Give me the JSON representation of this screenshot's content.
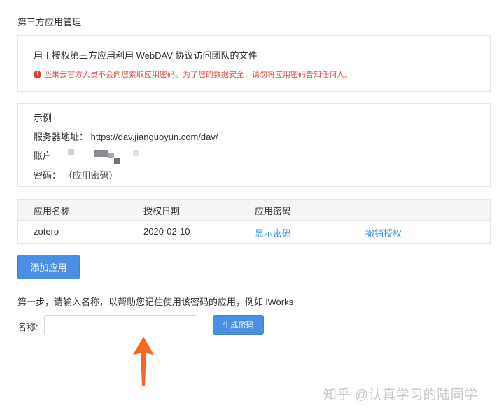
{
  "section_title": "第三方应用管理",
  "info": {
    "description": "用于授权第三方应用利用 WebDAV 协议访问团队的文件",
    "warning": "坚果云官方人员不会向您索取应用密码。为了您的数据安全，请勿将应用密码告知任何人。"
  },
  "example": {
    "heading": "示例",
    "server_label": "服务器地址：",
    "server_value": "https://dav.jianguoyun.com/dav/",
    "account_label": "账户",
    "password_label": "密码：",
    "password_value": "（应用密码）"
  },
  "apps_table": {
    "headers": [
      "应用名称",
      "授权日期",
      "应用密码"
    ],
    "rows": [
      {
        "name": "zotero",
        "date": "2020-02-10",
        "show_password": "显示密码",
        "revoke": "撤销授权"
      }
    ]
  },
  "add_app_button": "添加应用",
  "step_instruction": "第一步，请输入名称，以帮助您记住使用该密码的应用，例如 iWorks",
  "name_label": "名称:",
  "name_input_value": "",
  "generate_button": "生成密码",
  "watermark": "知乎 @认真学习的陆同学",
  "colors": {
    "accent": "#4a90e2",
    "link": "#3a8ee6",
    "warning": "#d9534f",
    "arrow": "#f26a21"
  },
  "icons": {
    "warning": "exclamation-circle-icon",
    "arrow": "up-arrow-annotation"
  }
}
